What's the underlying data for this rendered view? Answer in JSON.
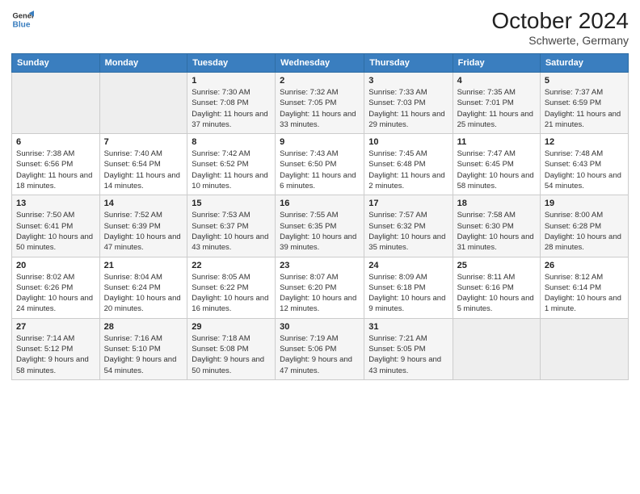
{
  "header": {
    "logo_line1": "General",
    "logo_line2": "Blue",
    "month": "October 2024",
    "location": "Schwerte, Germany"
  },
  "weekdays": [
    "Sunday",
    "Monday",
    "Tuesday",
    "Wednesday",
    "Thursday",
    "Friday",
    "Saturday"
  ],
  "weeks": [
    [
      {
        "day": "",
        "info": ""
      },
      {
        "day": "",
        "info": ""
      },
      {
        "day": "1",
        "info": "Sunrise: 7:30 AM\nSunset: 7:08 PM\nDaylight: 11 hours and 37 minutes."
      },
      {
        "day": "2",
        "info": "Sunrise: 7:32 AM\nSunset: 7:05 PM\nDaylight: 11 hours and 33 minutes."
      },
      {
        "day": "3",
        "info": "Sunrise: 7:33 AM\nSunset: 7:03 PM\nDaylight: 11 hours and 29 minutes."
      },
      {
        "day": "4",
        "info": "Sunrise: 7:35 AM\nSunset: 7:01 PM\nDaylight: 11 hours and 25 minutes."
      },
      {
        "day": "5",
        "info": "Sunrise: 7:37 AM\nSunset: 6:59 PM\nDaylight: 11 hours and 21 minutes."
      }
    ],
    [
      {
        "day": "6",
        "info": "Sunrise: 7:38 AM\nSunset: 6:56 PM\nDaylight: 11 hours and 18 minutes."
      },
      {
        "day": "7",
        "info": "Sunrise: 7:40 AM\nSunset: 6:54 PM\nDaylight: 11 hours and 14 minutes."
      },
      {
        "day": "8",
        "info": "Sunrise: 7:42 AM\nSunset: 6:52 PM\nDaylight: 11 hours and 10 minutes."
      },
      {
        "day": "9",
        "info": "Sunrise: 7:43 AM\nSunset: 6:50 PM\nDaylight: 11 hours and 6 minutes."
      },
      {
        "day": "10",
        "info": "Sunrise: 7:45 AM\nSunset: 6:48 PM\nDaylight: 11 hours and 2 minutes."
      },
      {
        "day": "11",
        "info": "Sunrise: 7:47 AM\nSunset: 6:45 PM\nDaylight: 10 hours and 58 minutes."
      },
      {
        "day": "12",
        "info": "Sunrise: 7:48 AM\nSunset: 6:43 PM\nDaylight: 10 hours and 54 minutes."
      }
    ],
    [
      {
        "day": "13",
        "info": "Sunrise: 7:50 AM\nSunset: 6:41 PM\nDaylight: 10 hours and 50 minutes."
      },
      {
        "day": "14",
        "info": "Sunrise: 7:52 AM\nSunset: 6:39 PM\nDaylight: 10 hours and 47 minutes."
      },
      {
        "day": "15",
        "info": "Sunrise: 7:53 AM\nSunset: 6:37 PM\nDaylight: 10 hours and 43 minutes."
      },
      {
        "day": "16",
        "info": "Sunrise: 7:55 AM\nSunset: 6:35 PM\nDaylight: 10 hours and 39 minutes."
      },
      {
        "day": "17",
        "info": "Sunrise: 7:57 AM\nSunset: 6:32 PM\nDaylight: 10 hours and 35 minutes."
      },
      {
        "day": "18",
        "info": "Sunrise: 7:58 AM\nSunset: 6:30 PM\nDaylight: 10 hours and 31 minutes."
      },
      {
        "day": "19",
        "info": "Sunrise: 8:00 AM\nSunset: 6:28 PM\nDaylight: 10 hours and 28 minutes."
      }
    ],
    [
      {
        "day": "20",
        "info": "Sunrise: 8:02 AM\nSunset: 6:26 PM\nDaylight: 10 hours and 24 minutes."
      },
      {
        "day": "21",
        "info": "Sunrise: 8:04 AM\nSunset: 6:24 PM\nDaylight: 10 hours and 20 minutes."
      },
      {
        "day": "22",
        "info": "Sunrise: 8:05 AM\nSunset: 6:22 PM\nDaylight: 10 hours and 16 minutes."
      },
      {
        "day": "23",
        "info": "Sunrise: 8:07 AM\nSunset: 6:20 PM\nDaylight: 10 hours and 12 minutes."
      },
      {
        "day": "24",
        "info": "Sunrise: 8:09 AM\nSunset: 6:18 PM\nDaylight: 10 hours and 9 minutes."
      },
      {
        "day": "25",
        "info": "Sunrise: 8:11 AM\nSunset: 6:16 PM\nDaylight: 10 hours and 5 minutes."
      },
      {
        "day": "26",
        "info": "Sunrise: 8:12 AM\nSunset: 6:14 PM\nDaylight: 10 hours and 1 minute."
      }
    ],
    [
      {
        "day": "27",
        "info": "Sunrise: 7:14 AM\nSunset: 5:12 PM\nDaylight: 9 hours and 58 minutes."
      },
      {
        "day": "28",
        "info": "Sunrise: 7:16 AM\nSunset: 5:10 PM\nDaylight: 9 hours and 54 minutes."
      },
      {
        "day": "29",
        "info": "Sunrise: 7:18 AM\nSunset: 5:08 PM\nDaylight: 9 hours and 50 minutes."
      },
      {
        "day": "30",
        "info": "Sunrise: 7:19 AM\nSunset: 5:06 PM\nDaylight: 9 hours and 47 minutes."
      },
      {
        "day": "31",
        "info": "Sunrise: 7:21 AM\nSunset: 5:05 PM\nDaylight: 9 hours and 43 minutes."
      },
      {
        "day": "",
        "info": ""
      },
      {
        "day": "",
        "info": ""
      }
    ]
  ]
}
